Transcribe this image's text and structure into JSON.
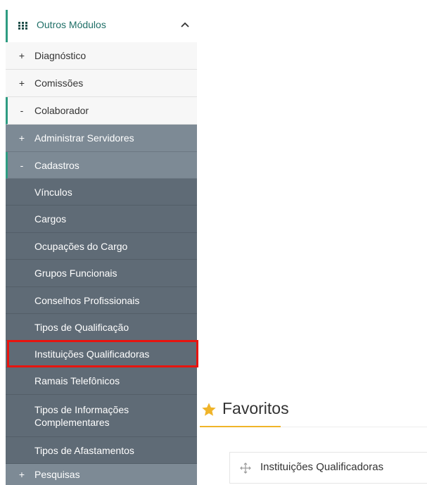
{
  "sidebar": {
    "module_title": "Outros Módulos",
    "items": [
      {
        "symbol": "+",
        "label": "Diagnóstico"
      },
      {
        "symbol": "+",
        "label": "Comissões"
      },
      {
        "symbol": "-",
        "label": "Colaborador"
      },
      {
        "symbol": "+",
        "label": "Administrar Servidores"
      },
      {
        "symbol": "-",
        "label": "Cadastros"
      },
      {
        "label": "Vínculos"
      },
      {
        "label": "Cargos"
      },
      {
        "label": "Ocupações do Cargo"
      },
      {
        "label": "Grupos Funcionais"
      },
      {
        "label": "Conselhos Profissionais"
      },
      {
        "label": "Tipos de Qualificação"
      },
      {
        "label": "Instituições Qualificadoras"
      },
      {
        "label": "Ramais Telefônicos"
      },
      {
        "label": "Tipos de Informações Complementares"
      },
      {
        "label": "Tipos de Afastamentos"
      },
      {
        "symbol": "+",
        "label": "Pesquisas"
      }
    ]
  },
  "favorites": {
    "title": "Favoritos",
    "items": [
      {
        "label": "Instituições Qualificadoras"
      }
    ]
  },
  "colors": {
    "accent": "#2e9c82",
    "star": "#f0b429",
    "highlight": "#e8140f",
    "menu_mid": "#7d8a95",
    "menu_dark": "#5f6b76"
  }
}
